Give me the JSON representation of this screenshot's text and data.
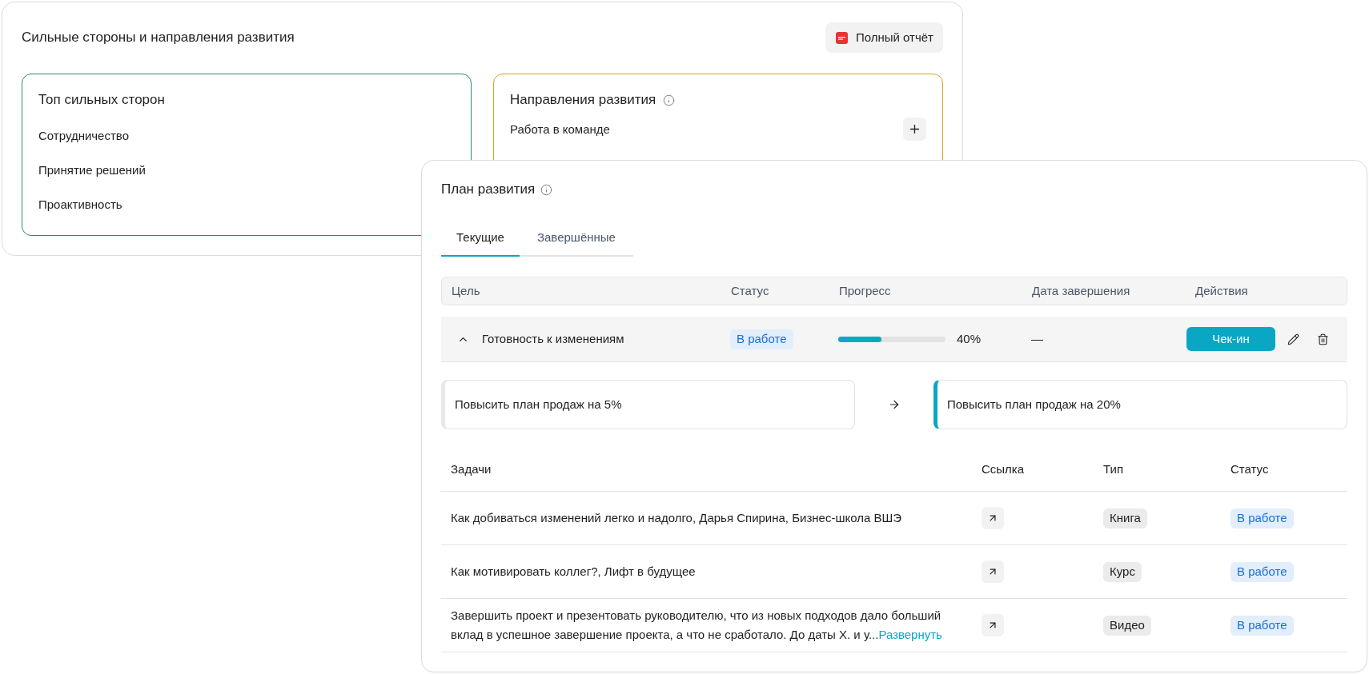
{
  "strengths_card": {
    "title": "Сильные стороны и направления развития",
    "report_button": {
      "label": "Полный отчёт"
    },
    "top_strengths": {
      "title": "Топ сильных сторон",
      "items": [
        "Сотрудничество",
        "Принятие решений",
        "Проактивность"
      ]
    },
    "growth_areas": {
      "title": "Направления развития",
      "items": [
        "Работа в команде"
      ]
    }
  },
  "plan_card": {
    "title": "План развития",
    "tabs": [
      {
        "label": "Текущие",
        "selected": true
      },
      {
        "label": "Завершённые",
        "selected": false
      }
    ],
    "goals_table": {
      "columns": [
        "Цель",
        "Статус",
        "Прогресс",
        "Дата завершения",
        "Действия"
      ],
      "rows": [
        {
          "goal": "Готовность к изменениям",
          "expanded": true,
          "status": "В работе",
          "level": 0.4,
          "progress": "40%",
          "end_date": "—",
          "checkin_button": "Чек-ин",
          "from": "Повысить план продаж на 5%",
          "to": "Повысить план продаж на 20%",
          "tasks_table": {
            "columns": [
              "Задачи",
              "Ссылка",
              "Тип",
              "Статус"
            ],
            "rows": [
              {
                "task": "Как добиваться изменений легко и надолго, Дарья Спирина, Бизнес-школа ВШЭ",
                "type": "Книга",
                "status": "В работе"
              },
              {
                "task": "Как мотивировать коллег?, Лифт в будущее",
                "type": "Курс",
                "status": "В работе"
              },
              {
                "task": "Завершить проект и презентовать руководителю, что из новых подходов дало больший вклад в успешное завершение проекта, а что не сработало. До даты Х. и у...",
                "expand_link": "Развернуть",
                "type": "Видео",
                "status": "В работе"
              }
            ]
          }
        }
      ]
    }
  }
}
